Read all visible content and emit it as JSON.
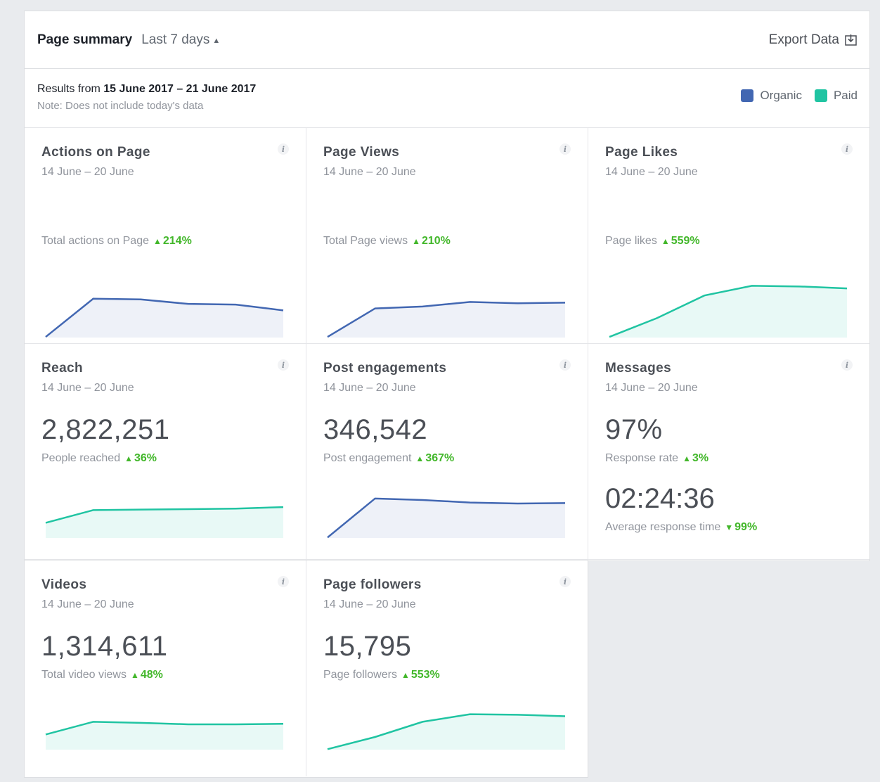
{
  "header": {
    "title": "Page summary",
    "period": "Last 7 days",
    "export_label": "Export Data"
  },
  "subheader": {
    "results_prefix": "Results from",
    "results_range": "15 June 2017 – 21 June 2017",
    "note": "Note: Does not include today's data"
  },
  "legend": [
    {
      "label": "Organic",
      "color": "#4267b2"
    },
    {
      "label": "Paid",
      "color": "#20c4a2"
    }
  ],
  "cards": [
    {
      "name": "Actions on Page",
      "date": "14 June – 20 June",
      "value": "",
      "metric": "Total actions on Page",
      "change": "214%",
      "direction": "up",
      "series": "organic",
      "spark": [
        1,
        60,
        59,
        52,
        51,
        42
      ]
    },
    {
      "name": "Page Views",
      "date": "14 June – 20 June",
      "value": "",
      "metric": "Total Page views",
      "change": "210%",
      "direction": "up",
      "series": "organic",
      "spark": [
        1,
        45,
        48,
        55,
        53,
        54
      ]
    },
    {
      "name": "Page Likes",
      "date": "14 June – 20 June",
      "value": "",
      "metric": "Page likes",
      "change": "559%",
      "direction": "up",
      "series": "paid",
      "spark": [
        1,
        30,
        65,
        80,
        79,
        76
      ]
    },
    {
      "name": "Reach",
      "date": "14 June – 20 June",
      "value": "2,822,251",
      "metric": "People reached",
      "change": "36%",
      "direction": "up",
      "series": "paid",
      "spark": [
        30,
        55,
        56,
        57,
        58,
        61
      ]
    },
    {
      "name": "Post engagements",
      "date": "14 June – 20 June",
      "value": "346,542",
      "metric": "Post engagement",
      "change": "367%",
      "direction": "up",
      "series": "organic",
      "spark": [
        1,
        78,
        75,
        70,
        68,
        69
      ]
    },
    {
      "name": "Messages",
      "date": "14 June – 20 June",
      "value": "97%",
      "metric": "Response rate",
      "change": "3%",
      "direction": "up",
      "value2": "02:24:36",
      "metric2": "Average response time",
      "change2": "99%",
      "direction2": "down"
    },
    {
      "name": "Videos",
      "date": "14 June – 20 June",
      "value": "1,314,611",
      "metric": "Total video views",
      "change": "48%",
      "direction": "up",
      "series": "paid",
      "spark": [
        30,
        55,
        53,
        50,
        50,
        51
      ]
    },
    {
      "name": "Page followers",
      "date": "14 June – 20 June",
      "value": "15,795",
      "metric": "Page followers",
      "change": "553%",
      "direction": "up",
      "series": "paid",
      "spark": [
        1,
        25,
        55,
        70,
        69,
        66
      ]
    }
  ]
}
